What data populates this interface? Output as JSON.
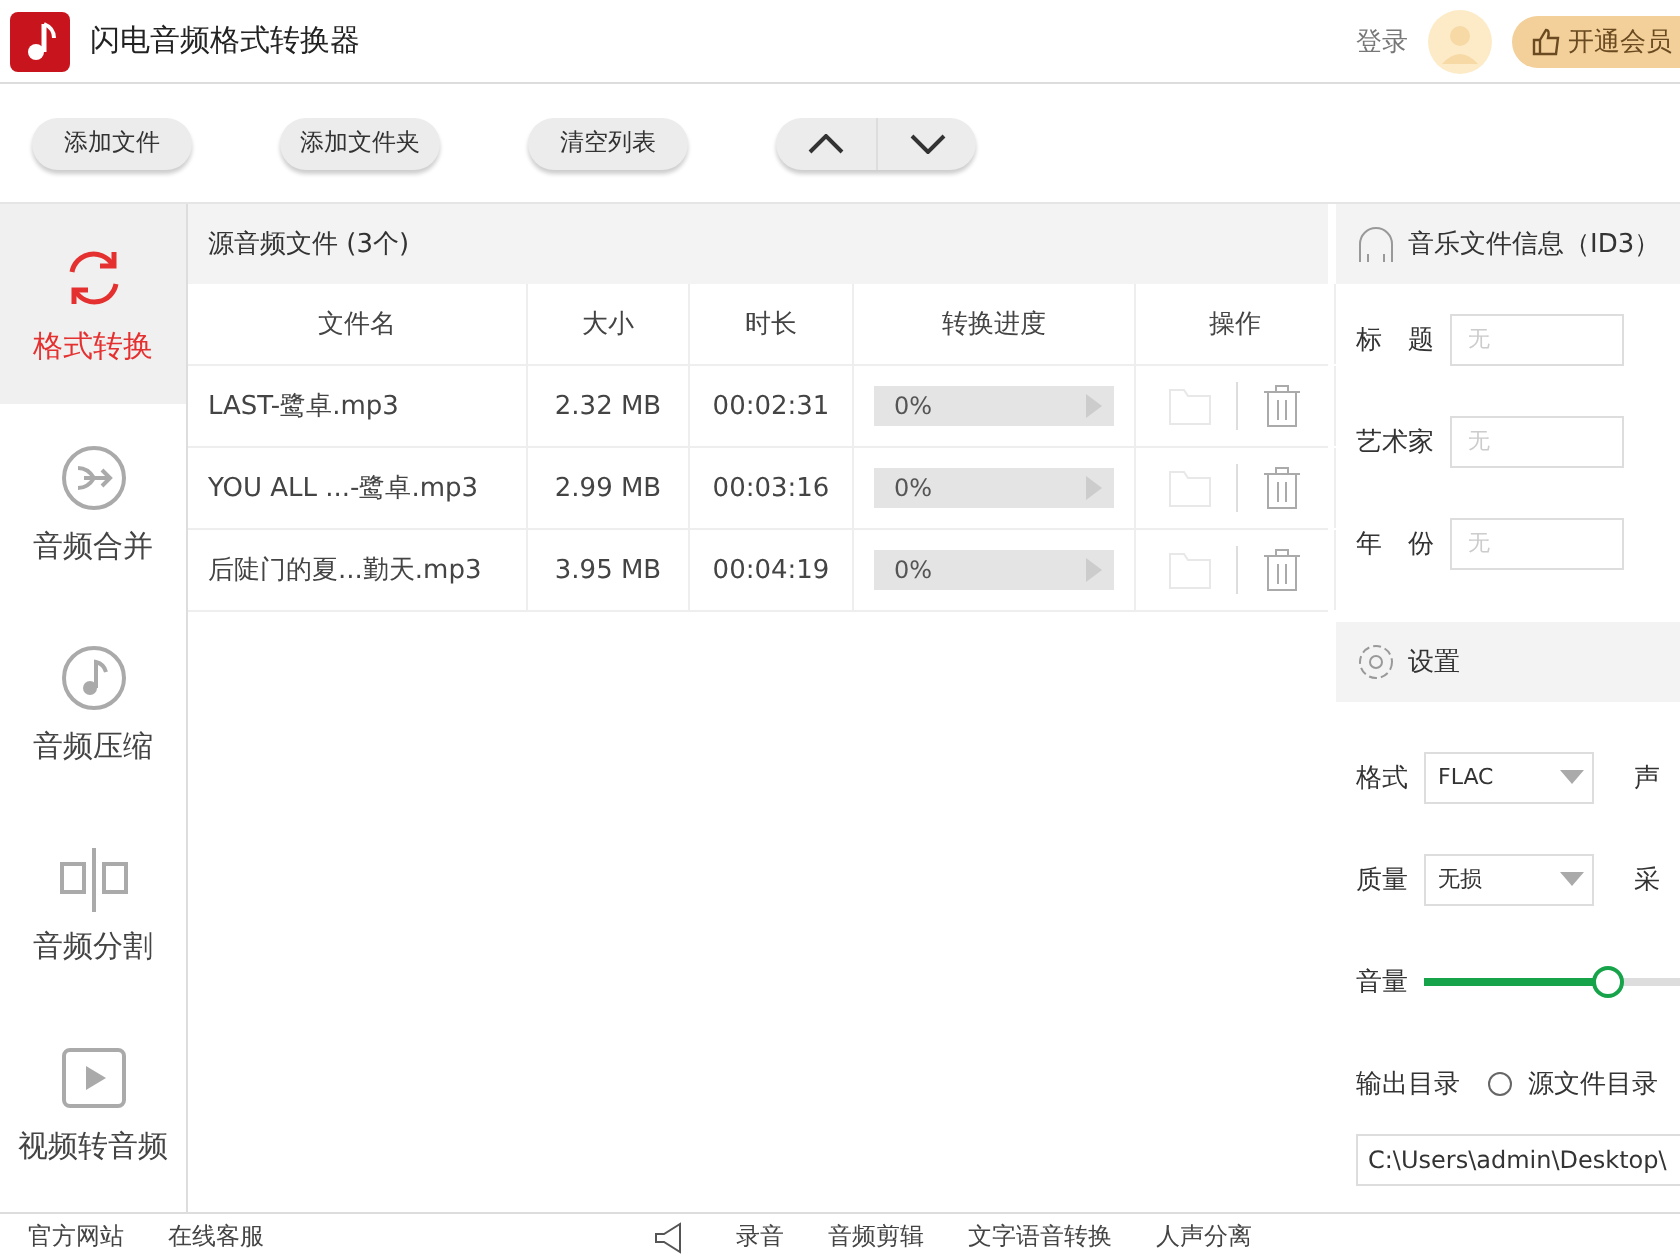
{
  "app": {
    "title": "闪电音频格式转换器",
    "login": "登录",
    "vip": "开通会员"
  },
  "toolbar": {
    "buttons": [
      "添加文件",
      "添加文件夹",
      "清空列表"
    ]
  },
  "sidebar": {
    "items": [
      {
        "label": "格式转换",
        "kind": "convert",
        "selected": true
      },
      {
        "label": "音频合并",
        "kind": "merge",
        "selected": false
      },
      {
        "label": "音频压缩",
        "kind": "compress",
        "selected": false
      },
      {
        "label": "音频分割",
        "kind": "split",
        "selected": false
      },
      {
        "label": "视频转音频",
        "kind": "video",
        "selected": false
      }
    ]
  },
  "files": {
    "title": "源音频文件 (3个)",
    "columns": [
      "文件名",
      "大小",
      "时长",
      "转换进度",
      "操作"
    ],
    "rows": [
      {
        "name": "LAST-鹭卓.mp3",
        "size": "2.32 MB",
        "duration": "00:02:31",
        "progress": "0%",
        "level": 0
      },
      {
        "name": "YOU ALL ...-鹭卓.mp3",
        "size": "2.99 MB",
        "duration": "00:03:16",
        "progress": "0%",
        "level": 0
      },
      {
        "name": "后陡门的夏...勤天.mp3",
        "size": "3.95 MB",
        "duration": "00:04:19",
        "progress": "0%",
        "level": 0
      }
    ]
  },
  "id3": {
    "title": "音乐文件信息（ID3）",
    "fields": [
      {
        "label": "标　题",
        "placeholder": "无"
      },
      {
        "label": "艺术家",
        "placeholder": "无"
      },
      {
        "label": "年　份",
        "placeholder": "无"
      }
    ]
  },
  "settings": {
    "title": "设置",
    "format_label": "格式",
    "format": "FLAC",
    "channel_label": "声",
    "quality_label": "质量",
    "quality": "无损",
    "sample_label": "采",
    "volume_label": "音量",
    "volume": {
      "level": 0.61
    },
    "output_label": "输出目录",
    "source_dir": {
      "label": "源文件目录",
      "selected": false
    },
    "path": "C:\\Users\\admin\\Desktop\\"
  },
  "footer": {
    "left": [
      "官方网站",
      "在线客服"
    ],
    "right": [
      "录音",
      "音频剪辑",
      "文字语音转换",
      "人声分离"
    ]
  }
}
